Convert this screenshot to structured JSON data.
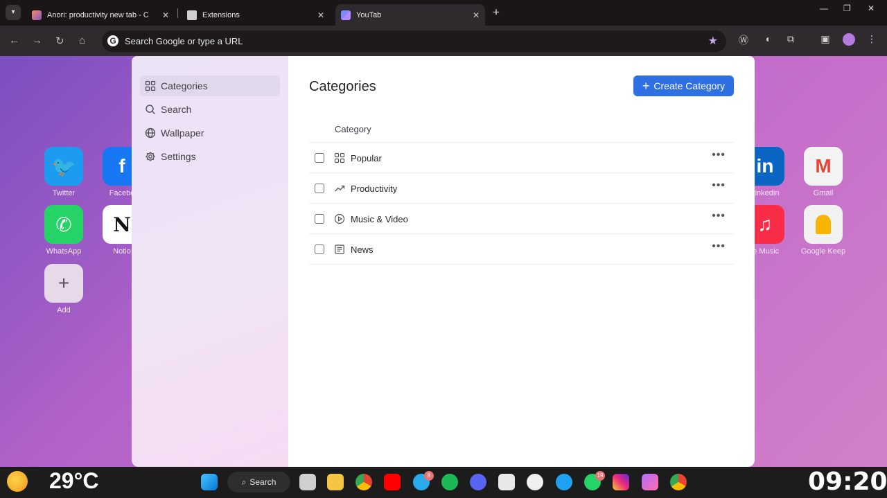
{
  "browser": {
    "tabs": [
      {
        "title": "Anori: productivity new tab - C"
      },
      {
        "title": "Extensions"
      },
      {
        "title": "YouTab"
      }
    ],
    "omnibox": {
      "placeholder": "Search Google or type a URL"
    }
  },
  "background_apps": [
    {
      "label": "Twitter",
      "color": "#1d9bf0",
      "glyph": "t"
    },
    {
      "label": "Facebo",
      "color": "#1877f2",
      "glyph": "f"
    },
    {
      "label": "WhatsApp",
      "color": "#25d366",
      "glyph": "w"
    },
    {
      "label": "Notio",
      "color": "#ffffff",
      "glyph": "N"
    },
    {
      "label": "Add",
      "color": "#e7d8ea",
      "glyph": "+"
    },
    {
      "label": "Linkedin",
      "color": "#0a66c2",
      "glyph": "in"
    },
    {
      "label": "Gmail",
      "color": "#f3f3f3",
      "glyph": "M"
    },
    {
      "label": "le Music",
      "color": "#fa2d48",
      "glyph": "♫"
    },
    {
      "label": "Google Keep",
      "color": "#f1f1f1",
      "glyph": "K"
    }
  ],
  "sidebar": {
    "items": [
      {
        "label": "Categories",
        "icon": "grid-icon",
        "active": true
      },
      {
        "label": "Search",
        "icon": "search-icon"
      },
      {
        "label": "Wallpaper",
        "icon": "globe-icon"
      },
      {
        "label": "Settings",
        "icon": "gear-icon"
      }
    ]
  },
  "main": {
    "title": "Categories",
    "create_button": "Create Category",
    "column_header": "Category",
    "rows": [
      {
        "name": "Popular",
        "icon": "grid-icon"
      },
      {
        "name": "Productivity",
        "icon": "trending-up-icon"
      },
      {
        "name": "Music & Video",
        "icon": "play-circle-icon"
      },
      {
        "name": "News",
        "icon": "newspaper-icon"
      }
    ]
  },
  "taskbar": {
    "temperature": "29°C",
    "search_label": "Search",
    "clock": "09:20",
    "badges": {
      "telegram": "8",
      "whatsapp": "19"
    }
  },
  "colors": {
    "accent": "#2f6fe4"
  }
}
